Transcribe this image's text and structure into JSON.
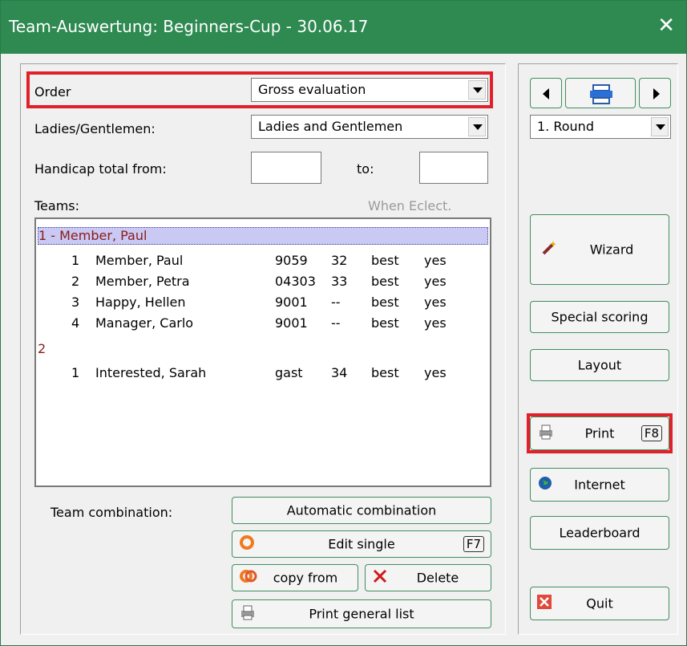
{
  "window": {
    "title": "Team-Auswertung: Beginners-Cup - 30.06.17",
    "close_glyph": "✕"
  },
  "form": {
    "order": {
      "label": "Order",
      "value": "Gross evaluation"
    },
    "ladies_gentlemen": {
      "label": "Ladies/Gentlemen:",
      "value": "Ladies and Gentlemen"
    },
    "handicap": {
      "label_from": "Handicap total from:",
      "label_to": "to:",
      "from_value": "",
      "to_value": ""
    },
    "teams_label": "Teams:",
    "when_eclect": "When Eclect."
  },
  "teams": [
    {
      "header": "1 - Member, Paul",
      "members": [
        {
          "pos": "1",
          "name": "Member, Paul",
          "id": "9059",
          "hcp": "32",
          "score": "best",
          "flag": "yes"
        },
        {
          "pos": "2",
          "name": "Member, Petra",
          "id": "04303",
          "hcp": "33",
          "score": "best",
          "flag": "yes"
        },
        {
          "pos": "3",
          "name": "Happy, Hellen",
          "id": "9001",
          "hcp": "--",
          "score": "best",
          "flag": "yes"
        },
        {
          "pos": "4",
          "name": "Manager, Carlo",
          "id": "9001",
          "hcp": "--",
          "score": "best",
          "flag": "yes"
        }
      ]
    },
    {
      "header": "2",
      "members": [
        {
          "pos": "1",
          "name": "Interested, Sarah",
          "id": "gast",
          "hcp": "34",
          "score": "best",
          "flag": "yes"
        }
      ]
    }
  ],
  "combination": {
    "label": "Team combination:",
    "automatic": "Automatic combination",
    "edit_single": "Edit single",
    "edit_single_key": "F7",
    "copy_from": "copy from",
    "delete": "Delete",
    "print_general": "Print general list"
  },
  "right": {
    "round_value": "1. Round",
    "wizard": "Wizard",
    "special_scoring": "Special scoring",
    "layout": "Layout",
    "print": "Print",
    "print_key": "F8",
    "internet": "Internet",
    "leaderboard": "Leaderboard",
    "quit": "Quit"
  },
  "colors": {
    "titlebar": "#2f8a52",
    "highlight_frame": "#e0202a",
    "team_header_text": "#8b1a1a",
    "selected_row": "#c9c9f3"
  }
}
